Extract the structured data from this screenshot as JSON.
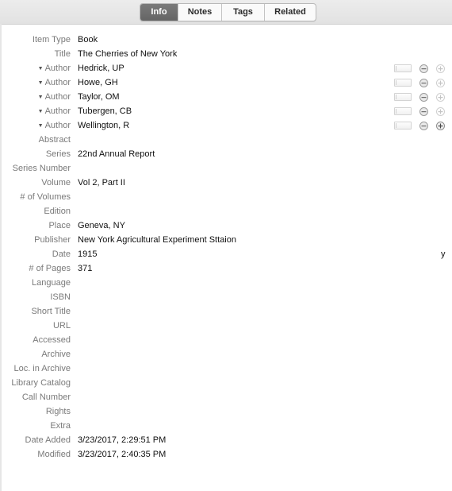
{
  "tabs": {
    "info": "Info",
    "notes": "Notes",
    "tags": "Tags",
    "related": "Related"
  },
  "fields": {
    "item_type": {
      "label": "Item Type",
      "value": "Book"
    },
    "title": {
      "label": "Title",
      "value": "The Cherries of New York"
    },
    "creators": [
      {
        "type": "Author",
        "name": "Hedrick, UP"
      },
      {
        "type": "Author",
        "name": "Howe, GH"
      },
      {
        "type": "Author",
        "name": "Taylor, OM"
      },
      {
        "type": "Author",
        "name": "Tubergen, CB"
      },
      {
        "type": "Author",
        "name": "Wellington, R"
      }
    ],
    "abstract": {
      "label": "Abstract",
      "value": ""
    },
    "series": {
      "label": "Series",
      "value": "22nd Annual Report"
    },
    "series_number": {
      "label": "Series Number",
      "value": ""
    },
    "volume": {
      "label": "Volume",
      "value": "Vol 2, Part II"
    },
    "num_volumes": {
      "label": "# of Volumes",
      "value": ""
    },
    "edition": {
      "label": "Edition",
      "value": ""
    },
    "place": {
      "label": "Place",
      "value": "Geneva, NY"
    },
    "publisher": {
      "label": "Publisher",
      "value": "New York Agricultural Experiment Sttaion"
    },
    "date": {
      "label": "Date",
      "value": "1915",
      "flag": "y"
    },
    "num_pages": {
      "label": "# of Pages",
      "value": "371"
    },
    "language": {
      "label": "Language",
      "value": ""
    },
    "isbn": {
      "label": "ISBN",
      "value": ""
    },
    "short_title": {
      "label": "Short Title",
      "value": ""
    },
    "url": {
      "label": "URL",
      "value": ""
    },
    "accessed": {
      "label": "Accessed",
      "value": ""
    },
    "archive": {
      "label": "Archive",
      "value": ""
    },
    "loc_in_archive": {
      "label": "Loc. in Archive",
      "value": ""
    },
    "library_catalog": {
      "label": "Library Catalog",
      "value": ""
    },
    "call_number": {
      "label": "Call Number",
      "value": ""
    },
    "rights": {
      "label": "Rights",
      "value": ""
    },
    "extra": {
      "label": "Extra",
      "value": ""
    },
    "date_added": {
      "label": "Date Added",
      "value": "3/23/2017, 2:29:51 PM"
    },
    "modified": {
      "label": "Modified",
      "value": "3/23/2017, 2:40:35 PM"
    }
  },
  "icons": {
    "creator_type_menu": "caret-down-icon",
    "mode_switch": "name-mode-switch-icon",
    "remove": "minus-circle-icon",
    "add": "plus-circle-icon"
  }
}
